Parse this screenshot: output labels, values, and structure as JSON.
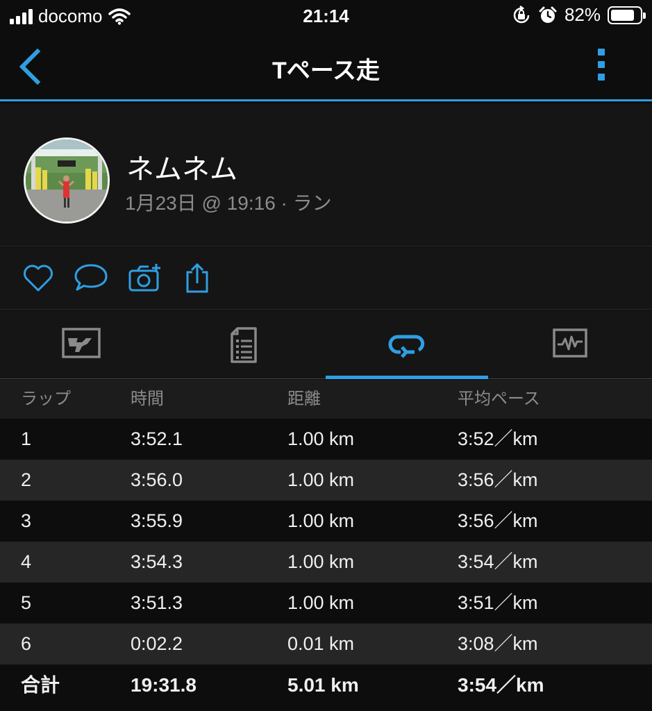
{
  "status_bar": {
    "carrier": "docomo",
    "time": "21:14",
    "battery_percent": "82%",
    "battery_level": 0.82
  },
  "nav": {
    "title": "Tペース走"
  },
  "profile": {
    "name": "ネムネム",
    "meta": "1月23日 @ 19:16 · ラン"
  },
  "colors": {
    "accent": "#2f9fe3",
    "background": "#0d0d0d",
    "panel": "#151515",
    "row_alt": "#262626",
    "muted_text": "#8c8c8c",
    "tab_icon": "#8a8a8a"
  },
  "actions": [
    "heart-icon",
    "comment-icon",
    "add-photo-icon",
    "share-icon"
  ],
  "tabs": [
    "map-tab",
    "details-tab",
    "laps-tab",
    "charts-tab"
  ],
  "active_tab": "laps-tab",
  "laps": {
    "headers": [
      "ラップ",
      "時間",
      "距離",
      "平均ペース"
    ],
    "rows": [
      [
        "1",
        "3:52.1",
        "1.00 km",
        "3:52／km"
      ],
      [
        "2",
        "3:56.0",
        "1.00 km",
        "3:56／km"
      ],
      [
        "3",
        "3:55.9",
        "1.00 km",
        "3:56／km"
      ],
      [
        "4",
        "3:54.3",
        "1.00 km",
        "3:54／km"
      ],
      [
        "5",
        "3:51.3",
        "1.00 km",
        "3:51／km"
      ],
      [
        "6",
        "0:02.2",
        "0.01 km",
        "3:08／km"
      ]
    ],
    "total": [
      "合計",
      "19:31.8",
      "5.01 km",
      "3:54／km"
    ]
  }
}
